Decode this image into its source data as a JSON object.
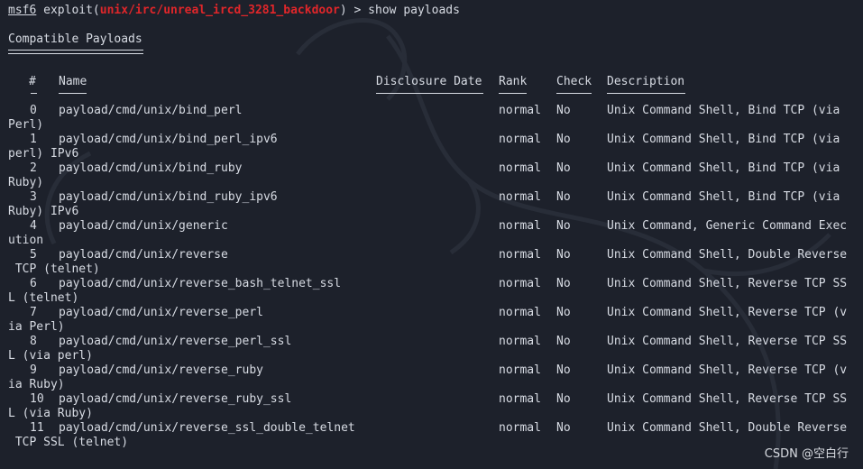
{
  "command_line": {
    "prefix": "msf6",
    "exploit_word": "exploit(",
    "module": "unix/irc/unreal_ircd_3281_backdoor",
    "suffix": ") > show payloads"
  },
  "section_title": "Compatible Payloads",
  "headers": {
    "num": "#",
    "name": "Name",
    "date": "Disclosure Date",
    "rank": "Rank",
    "check": "Check",
    "desc": "Description"
  },
  "rows": [
    {
      "num": "0",
      "name": "payload/cmd/unix/bind_perl",
      "rank": "normal",
      "check": "No",
      "desc": "Unix Command Shell, Bind TCP (via",
      "wrap": "Perl)"
    },
    {
      "num": "1",
      "name": "payload/cmd/unix/bind_perl_ipv6",
      "rank": "normal",
      "check": "No",
      "desc": "Unix Command Shell, Bind TCP (via",
      "wrap": "perl) IPv6"
    },
    {
      "num": "2",
      "name": "payload/cmd/unix/bind_ruby",
      "rank": "normal",
      "check": "No",
      "desc": "Unix Command Shell, Bind TCP (via",
      "wrap": "Ruby)"
    },
    {
      "num": "3",
      "name": "payload/cmd/unix/bind_ruby_ipv6",
      "rank": "normal",
      "check": "No",
      "desc": "Unix Command Shell, Bind TCP (via",
      "wrap": "Ruby) IPv6"
    },
    {
      "num": "4",
      "name": "payload/cmd/unix/generic",
      "rank": "normal",
      "check": "No",
      "desc": "Unix Command, Generic Command Exec",
      "wrap": "ution"
    },
    {
      "num": "5",
      "name": "payload/cmd/unix/reverse",
      "rank": "normal",
      "check": "No",
      "desc": "Unix Command Shell, Double Reverse",
      "wrap": " TCP (telnet)"
    },
    {
      "num": "6",
      "name": "payload/cmd/unix/reverse_bash_telnet_ssl",
      "rank": "normal",
      "check": "No",
      "desc": "Unix Command Shell, Reverse TCP SS",
      "wrap": "L (telnet)"
    },
    {
      "num": "7",
      "name": "payload/cmd/unix/reverse_perl",
      "rank": "normal",
      "check": "No",
      "desc": "Unix Command Shell, Reverse TCP (v",
      "wrap": "ia Perl)"
    },
    {
      "num": "8",
      "name": "payload/cmd/unix/reverse_perl_ssl",
      "rank": "normal",
      "check": "No",
      "desc": "Unix Command Shell, Reverse TCP SS",
      "wrap": "L (via perl)"
    },
    {
      "num": "9",
      "name": "payload/cmd/unix/reverse_ruby",
      "rank": "normal",
      "check": "No",
      "desc": "Unix Command Shell, Reverse TCP (v",
      "wrap": "ia Ruby)"
    },
    {
      "num": "10",
      "name": "payload/cmd/unix/reverse_ruby_ssl",
      "rank": "normal",
      "check": "No",
      "desc": "Unix Command Shell, Reverse TCP SS",
      "wrap": "L (via Ruby)"
    },
    {
      "num": "11",
      "name": "payload/cmd/unix/reverse_ssl_double_telnet",
      "rank": "normal",
      "check": "No",
      "desc": "Unix Command Shell, Double Reverse",
      "wrap": " TCP SSL (telnet)"
    }
  ],
  "watermark": "CSDN @空白行",
  "colors": {
    "background": "#1d212b",
    "text": "#d7dbe3",
    "module": "#e0262a"
  }
}
